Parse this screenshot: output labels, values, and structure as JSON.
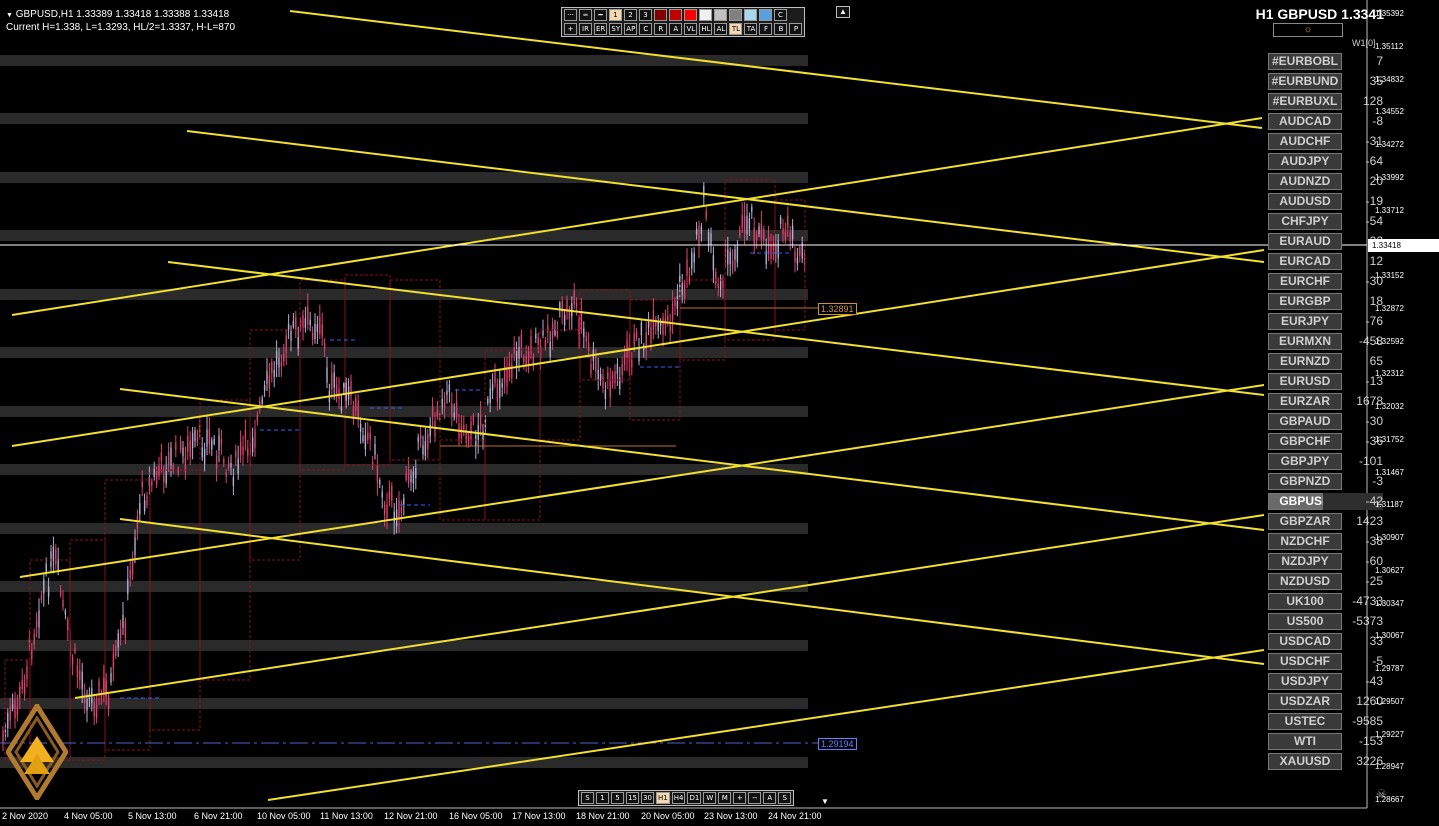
{
  "header": {
    "line1": "GBPUSD,H1  1.33389 1.33418 1.33388 1.33418",
    "line2": "Current H=1.338, L=1.3293, HL/2=1.3337, H-L=870",
    "arrow": "▼"
  },
  "title": "H1 GBPUSD 1.3341",
  "period_label": "W1[0]",
  "sun_icon": "☼",
  "skull_icon": "☠",
  "toolbar_top": {
    "row1": [
      "···",
      "═",
      "━",
      "1",
      "2",
      "3",
      "",
      "",
      "",
      "",
      "",
      "",
      "",
      "",
      "C"
    ],
    "row1_colors": [
      "#800000",
      "#c00000",
      "#ff0000",
      "#f0f0f0",
      "#c0c0c0",
      "#808080",
      "#a8d8f0",
      "#5aa0e0",
      "#1e6ed8"
    ],
    "row2": [
      "+",
      "IR",
      "ER",
      "SY",
      "AP",
      "C",
      "R",
      "A",
      "VL",
      "HL",
      "AL",
      "TL",
      "TA",
      "F",
      "B",
      "P"
    ]
  },
  "toolbar_bottom": [
    "S",
    "1",
    "5",
    "15",
    "30",
    "H1",
    "H4",
    "D1",
    "W",
    "M",
    "+",
    "−",
    "A",
    "S"
  ],
  "current_price": "1.33418",
  "level_labels": [
    {
      "text": "1.32891",
      "color": "#d09040"
    },
    {
      "text": "1.29194",
      "color": "#6080ff"
    }
  ],
  "price_ticks": [
    "1.35392",
    "1.35112",
    "1.34832",
    "1.34552",
    "1.34272",
    "1.33992",
    "1.33712",
    "1.33432",
    "1.33152",
    "1.32872",
    "1.32592",
    "1.32312",
    "1.32032",
    "1.31752",
    "1.31467",
    "1.31187",
    "1.30907",
    "1.30627",
    "1.30347",
    "1.30067",
    "1.29787",
    "1.29507",
    "1.29227",
    "1.28947",
    "1.28667"
  ],
  "time_ticks": [
    "2 Nov 2020",
    "4 Nov 05:00",
    "5 Nov 13:00",
    "6 Nov 21:00",
    "10 Nov 05:00",
    "11 Nov 13:00",
    "12 Nov 21:00",
    "16 Nov 05:00",
    "17 Nov 13:00",
    "18 Nov 21:00",
    "20 Nov 05:00",
    "23 Nov 13:00",
    "24 Nov 21:00"
  ],
  "symbols": [
    {
      "name": "#EURBOBL",
      "value": "7"
    },
    {
      "name": "#EURBUND",
      "value": "35"
    },
    {
      "name": "#EURBUXL",
      "value": "128"
    },
    {
      "name": "AUDCAD",
      "value": "-8"
    },
    {
      "name": "AUDCHF",
      "value": "-31"
    },
    {
      "name": "AUDJPY",
      "value": "-64"
    },
    {
      "name": "AUDNZD",
      "value": "20"
    },
    {
      "name": "AUDUSD",
      "value": "-19"
    },
    {
      "name": "CHFJPY",
      "value": "-54"
    },
    {
      "name": "EURAUD",
      "value": "32"
    },
    {
      "name": "EURCAD",
      "value": "12"
    },
    {
      "name": "EURCHF",
      "value": "-30"
    },
    {
      "name": "EURGBP",
      "value": "18"
    },
    {
      "name": "EURJPY",
      "value": "-76"
    },
    {
      "name": "EURMXN",
      "value": "-458"
    },
    {
      "name": "EURNZD",
      "value": "65"
    },
    {
      "name": "EURUSD",
      "value": "-13"
    },
    {
      "name": "EURZAR",
      "value": "1678"
    },
    {
      "name": "GBPAUD",
      "value": "-30"
    },
    {
      "name": "GBPCHF",
      "value": "-36"
    },
    {
      "name": "GBPJPY",
      "value": "-101"
    },
    {
      "name": "GBPNZD",
      "value": "-3"
    },
    {
      "name": "GBPUSD",
      "value": "-42",
      "active": true
    },
    {
      "name": "GBPZAR",
      "value": "1423"
    },
    {
      "name": "NZDCHF",
      "value": "-38"
    },
    {
      "name": "NZDJPY",
      "value": "-60"
    },
    {
      "name": "NZDUSD",
      "value": "-25"
    },
    {
      "name": "UK100",
      "value": "-4733"
    },
    {
      "name": "US500",
      "value": "-5373"
    },
    {
      "name": "USDCAD",
      "value": "33"
    },
    {
      "name": "USDCHF",
      "value": "-5"
    },
    {
      "name": "USDJPY",
      "value": "-43"
    },
    {
      "name": "USDZAR",
      "value": "1260"
    },
    {
      "name": "USTEC",
      "value": "-9585"
    },
    {
      "name": "WTI",
      "value": "-153"
    },
    {
      "name": "XAUUSD",
      "value": "3226"
    }
  ],
  "colors": {
    "trendline": "#f0e030",
    "band": "#2a2a2a",
    "bull_candle": "#b0b0d0",
    "bear_candle": "#e04070",
    "box_red": "#8b1020",
    "box_blue": "#3060ff",
    "crosshair": "#ffffff"
  }
}
